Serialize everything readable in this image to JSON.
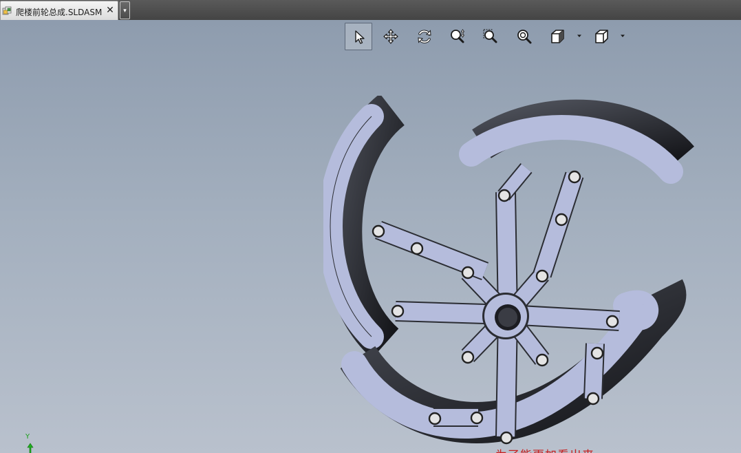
{
  "window": {
    "tab_title": "爬楼前轮总成.SLDASM",
    "close_glyph": "✕",
    "dropdown_glyph": "▾",
    "tab_icon": "assembly-document-icon"
  },
  "toolbar": {
    "items": [
      {
        "name": "select",
        "icon": "select-arrow-icon",
        "active": true
      },
      {
        "name": "pan",
        "icon": "pan-icon"
      },
      {
        "name": "rotate",
        "icon": "rotate-icon"
      },
      {
        "name": "zoom-in-out",
        "icon": "zoom-in-out-icon"
      },
      {
        "name": "zoom-to-area",
        "icon": "zoom-to-area-icon"
      },
      {
        "name": "zoom-to-fit",
        "icon": "zoom-to-fit-icon"
      },
      {
        "name": "display-style",
        "icon": "display-style-icon",
        "has_dropdown": true
      },
      {
        "name": "view-orientation",
        "icon": "view-orientation-icon",
        "has_dropdown": true
      }
    ]
  },
  "viewport": {
    "background_top": "#8e9cae",
    "background_bottom": "#b9c1cd",
    "model_fill": "#b5bcdc",
    "model_shade": "#2b2d33",
    "triad_label": "Y",
    "partial_red_text": "为了能更加看出来"
  },
  "model_data": {
    "rim_segments": 3,
    "spokes": 8,
    "pins": 16
  }
}
